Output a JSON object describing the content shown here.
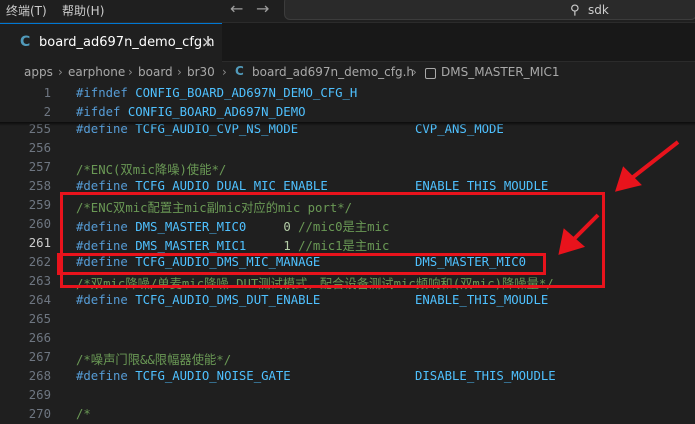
{
  "menu": {
    "terminal": "终端(T)",
    "help": "帮助(H)"
  },
  "nav": {
    "back": "←",
    "forward": "→"
  },
  "search": {
    "value": "sdk"
  },
  "tab": {
    "label": "board_ad697n_demo_cfg.h",
    "close": "×"
  },
  "breadcrumb": {
    "items": [
      "apps",
      "earphone",
      "board",
      "br30",
      "board_ad697n_demo_cfg.h",
      "DMS_MASTER_MIC1"
    ]
  },
  "lines": [
    {
      "n": "1",
      "kw": "#ifndef",
      "mac": "CONFIG_BOARD_AD697N_DEMO_CFG_H"
    },
    {
      "n": "2",
      "kw": "#ifdef",
      "mac": "CONFIG_BOARD_AD697N_DEMO"
    },
    {
      "n": "255",
      "kw": "#define",
      "mac": "TCFG_AUDIO_CVP_NS_MODE",
      "val": "CVP_ANS_MODE"
    },
    {
      "n": "256"
    },
    {
      "n": "257",
      "com": "/*ENC(双mic降噪)使能*/"
    },
    {
      "n": "258",
      "kw": "#define",
      "mac": "TCFG_AUDIO_DUAL_MIC_ENABLE",
      "val": "ENABLE_THIS_MOUDLE"
    },
    {
      "n": "259",
      "com": "/*ENC双mic配置主mic副mic对应的mic port*/"
    },
    {
      "n": "260",
      "kw": "#define",
      "mac": "DMS_MASTER_MIC0",
      "num": "0",
      "com": "//mic0是主mic"
    },
    {
      "n": "261",
      "kw": "#define",
      "mac": "DMS_MASTER_MIC1",
      "num": "1",
      "com": "//mic1是主mic"
    },
    {
      "n": "262",
      "kw": "#define",
      "mac": "TCFG_AUDIO_DMS_MIC_MANAGE",
      "val": "DMS_MASTER_MIC0"
    },
    {
      "n": "263",
      "com": "/*双mic降噪/单麦mic降噪 DUT测试模式，配合设备测试mic频响和(双mic)降噪量*/"
    },
    {
      "n": "264",
      "kw": "#define",
      "mac": "TCFG_AUDIO_DMS_DUT_ENABLE",
      "val": "ENABLE_THIS_MOUDLE"
    },
    {
      "n": "265"
    },
    {
      "n": "266"
    },
    {
      "n": "267",
      "com": "/*噪声门限&&限幅器使能*/"
    },
    {
      "n": "268",
      "kw": "#define",
      "mac": "TCFG_AUDIO_NOISE_GATE",
      "val": "DISABLE_THIS_MOUDLE"
    },
    {
      "n": "269"
    },
    {
      "n": "270",
      "com": "/*"
    }
  ],
  "colors": {
    "highlight": "#e8131c",
    "accent": "#0078d4"
  }
}
